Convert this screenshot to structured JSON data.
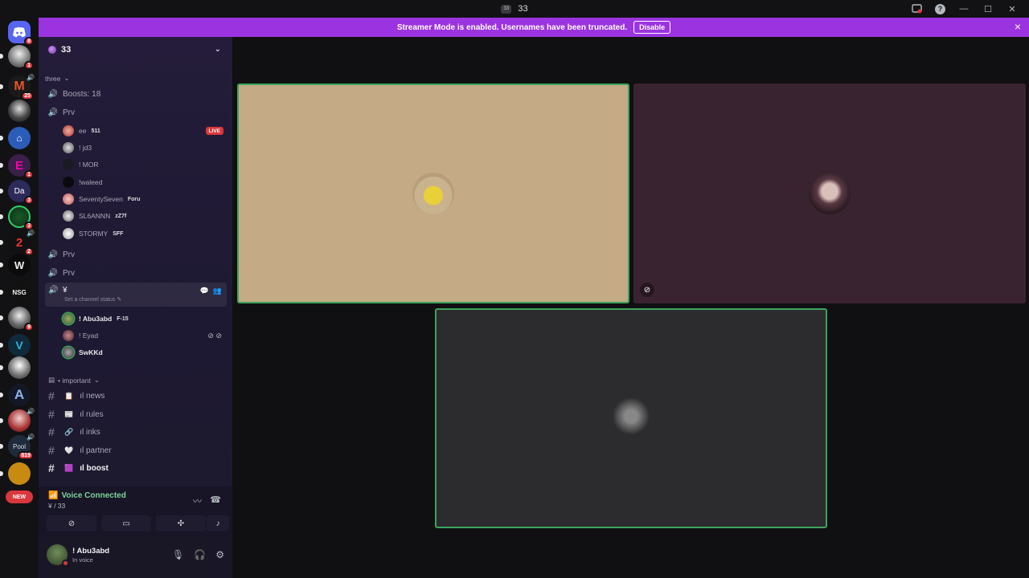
{
  "window": {
    "title": "33",
    "title_badge": "33"
  },
  "banner": {
    "text": "Streamer Mode is enabled. Usernames have been truncated.",
    "button": "Disable"
  },
  "guild": {
    "name": "33"
  },
  "sidebar": {
    "category_three": "three",
    "boosts": "Boosts: 18",
    "voice_channel_1": "Prv",
    "members_1": [
      {
        "name": "ee",
        "tag": "511",
        "live": "LIVE"
      },
      {
        "name": "! jd3"
      },
      {
        "name": "! MOR"
      },
      {
        "name": "!waleed"
      },
      {
        "name": "SeventySeven",
        "tag": "Foru"
      },
      {
        "name": "SL6ANNN",
        "tag": "zZ7f"
      },
      {
        "name": "STORMY",
        "tag": "SFF"
      }
    ],
    "voice_channel_2": "Prv",
    "voice_channel_3": "Prv",
    "active_channel": "¥",
    "active_channel_status": "Set a channel status",
    "members_active": [
      {
        "name": "! Abu3abd",
        "tag": "F-15"
      },
      {
        "name": "! Eyad"
      },
      {
        "name": "SwKKd"
      }
    ],
    "category_important": "• important",
    "text_channels": [
      {
        "name": "ıl news",
        "emoji": "📋"
      },
      {
        "name": "ıl rules",
        "emoji": "📰"
      },
      {
        "name": "ıl inks",
        "emoji": "🔗"
      },
      {
        "name": "ıl partner",
        "emoji": "🤍"
      },
      {
        "name": "ıl boost",
        "emoji": "🟪"
      }
    ]
  },
  "rail": {
    "badges": [
      "8",
      "1",
      "25",
      "1",
      "3",
      "3",
      "2",
      "9",
      "819"
    ],
    "new_label": "NEW"
  },
  "voice_panel": {
    "title": "Voice Connected",
    "subtitle": "¥ / 33"
  },
  "user_panel": {
    "name": "! Abu3abd",
    "status": "In voice"
  },
  "colors": {
    "accent": "#9b34e0",
    "speaking": "#3ba55d",
    "live": "#da373c"
  },
  "icons": [
    "discord-logo",
    "speaker-icon",
    "hash-icon",
    "mic-icon",
    "headphones-icon",
    "gear-icon",
    "camera-off-icon",
    "screen-share-icon",
    "activities-icon",
    "soundboard-icon",
    "disconnect-icon",
    "noise-suppression-icon"
  ]
}
